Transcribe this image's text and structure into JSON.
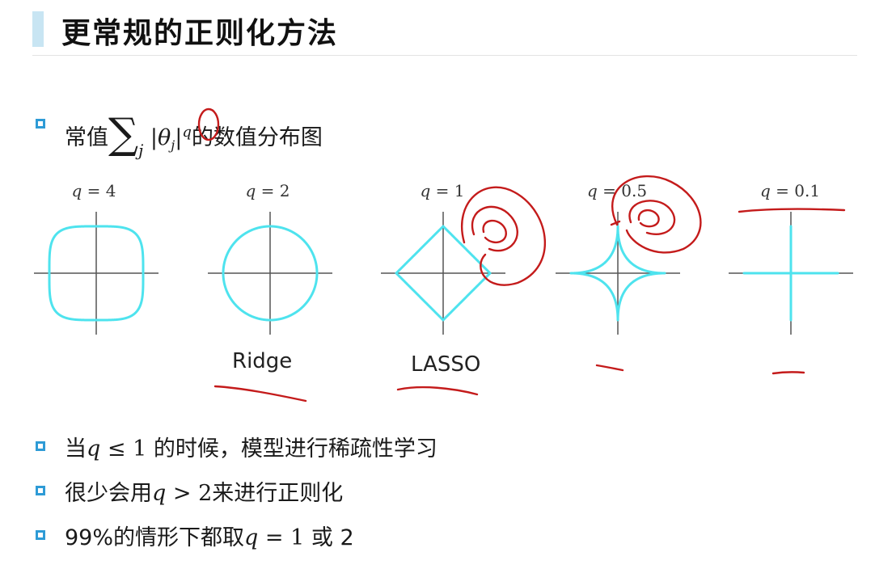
{
  "header": {
    "title": "更常规的正则化方法"
  },
  "intro": {
    "prefix": "常值",
    "sum_symbol": "∑",
    "sum_index": "j",
    "abs_open": "|θ",
    "abs_sub": "j",
    "abs_close": "|",
    "exponent": "q",
    "suffix": "的数值分布图"
  },
  "figures": [
    {
      "label_var": "q",
      "label_value": "= 4",
      "name": "",
      "exponent": 4
    },
    {
      "label_var": "q",
      "label_value": "= 2",
      "name": "Ridge",
      "exponent": 2
    },
    {
      "label_var": "q",
      "label_value": "= 1",
      "name": "LASSO",
      "exponent": 1
    },
    {
      "label_var": "q",
      "label_value": "= 0.5",
      "name": "",
      "exponent": 0.5
    },
    {
      "label_var": "q",
      "label_value": "= 0.1",
      "name": "",
      "exponent": 0.1
    }
  ],
  "bullets": [
    {
      "before": "当",
      "var": "q",
      "math": " ≤ 1",
      "after": " 的时候，模型进行稀疏性学习"
    },
    {
      "before": "很少会用",
      "var": "q",
      "math": " > 2",
      "after": "来进行正则化"
    },
    {
      "before": "99%的情形下都取",
      "var": "q",
      "math": " = 1",
      "after": " 或 2"
    }
  ],
  "colors": {
    "accent_bar": "#c8e5f3",
    "bullet": "#2e9bd6",
    "curve": "#4ee3ee",
    "axis": "#555555",
    "annotation": "#c41b1b"
  }
}
